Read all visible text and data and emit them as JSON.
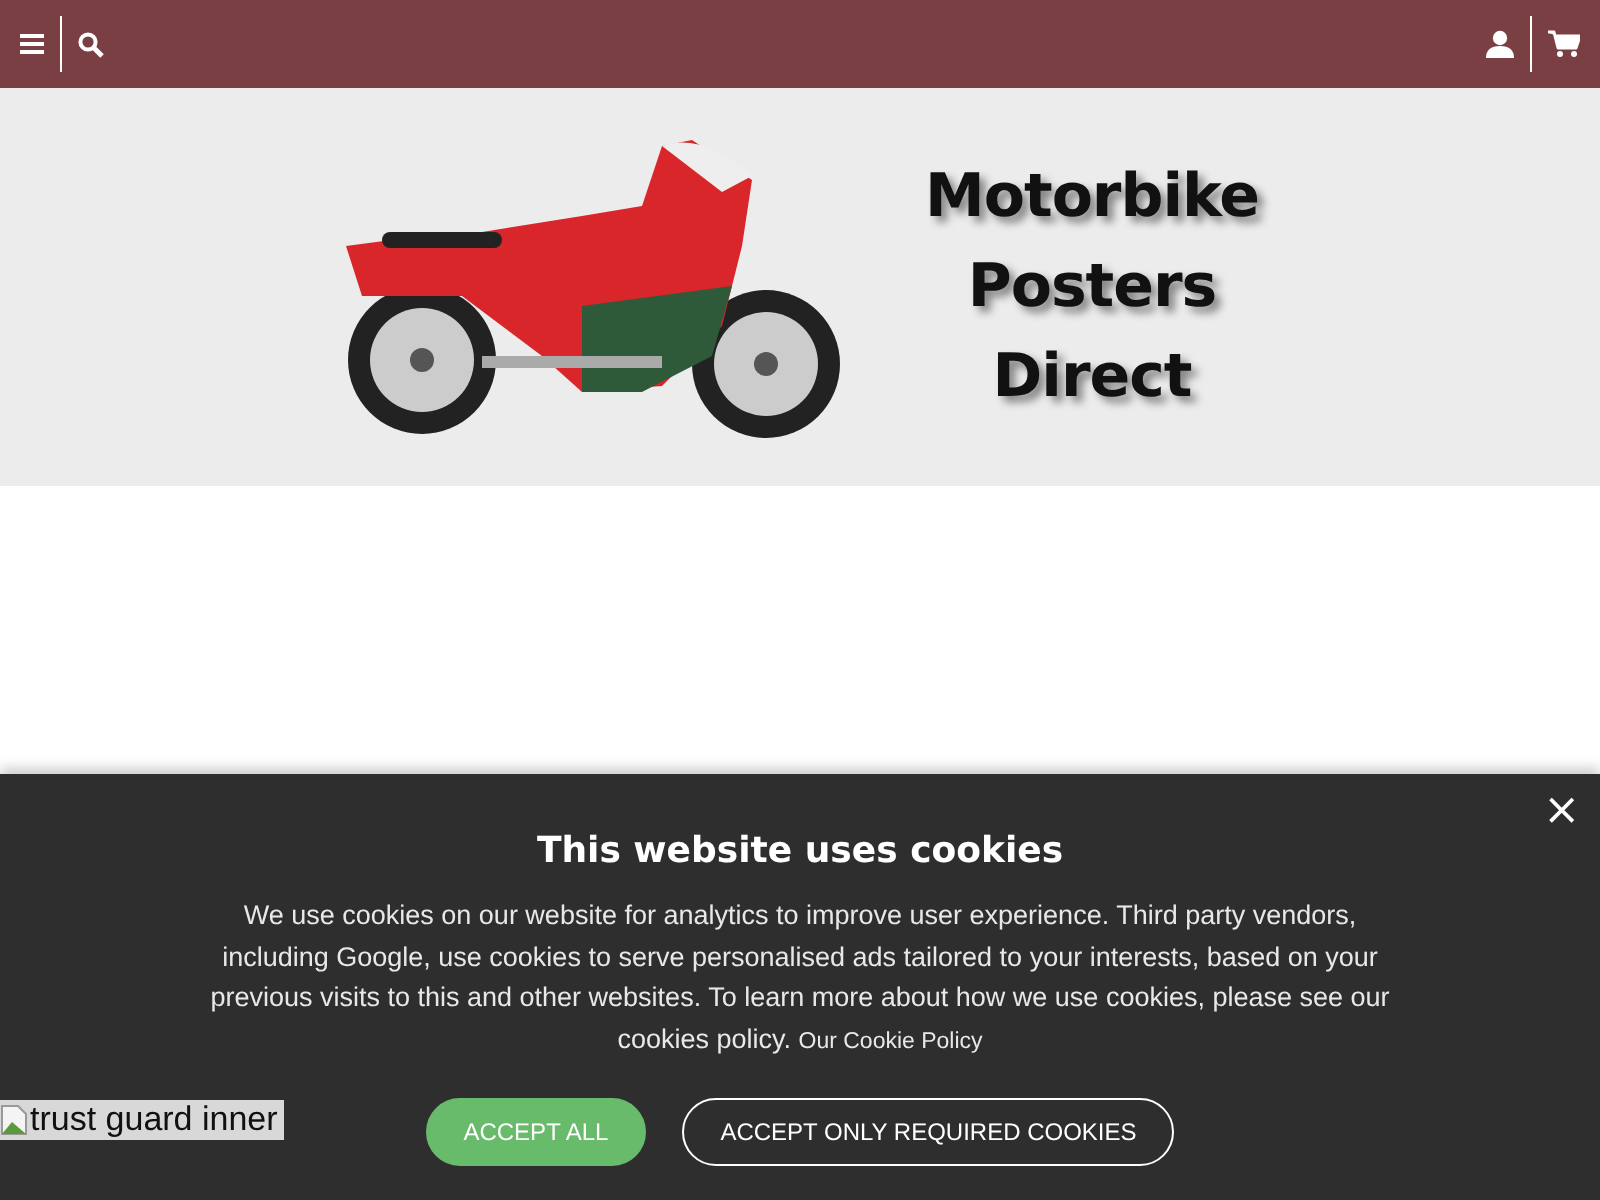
{
  "logo": {
    "lines": [
      "Motorbike",
      "Posters",
      "Direct"
    ]
  },
  "cookie_banner": {
    "close": "×",
    "title": "This website uses cookies",
    "text": "We use cookies on our website for analytics to improve user experience. Third party vendors, including Google, use cookies to serve personalised ads tailored to your interests, based on your previous visits to this and other websites. To learn more about how we use cookies, please see our cookies policy.",
    "link": "Our Cookie Policy",
    "buttons": [
      {
        "label": "ACCEPT ALL",
        "kind": "primary"
      },
      {
        "label": "ACCEPT ONLY REQUIRED COOKIES",
        "kind": "outline"
      }
    ]
  },
  "trust_badge": {
    "alt": "trust guard inner"
  }
}
